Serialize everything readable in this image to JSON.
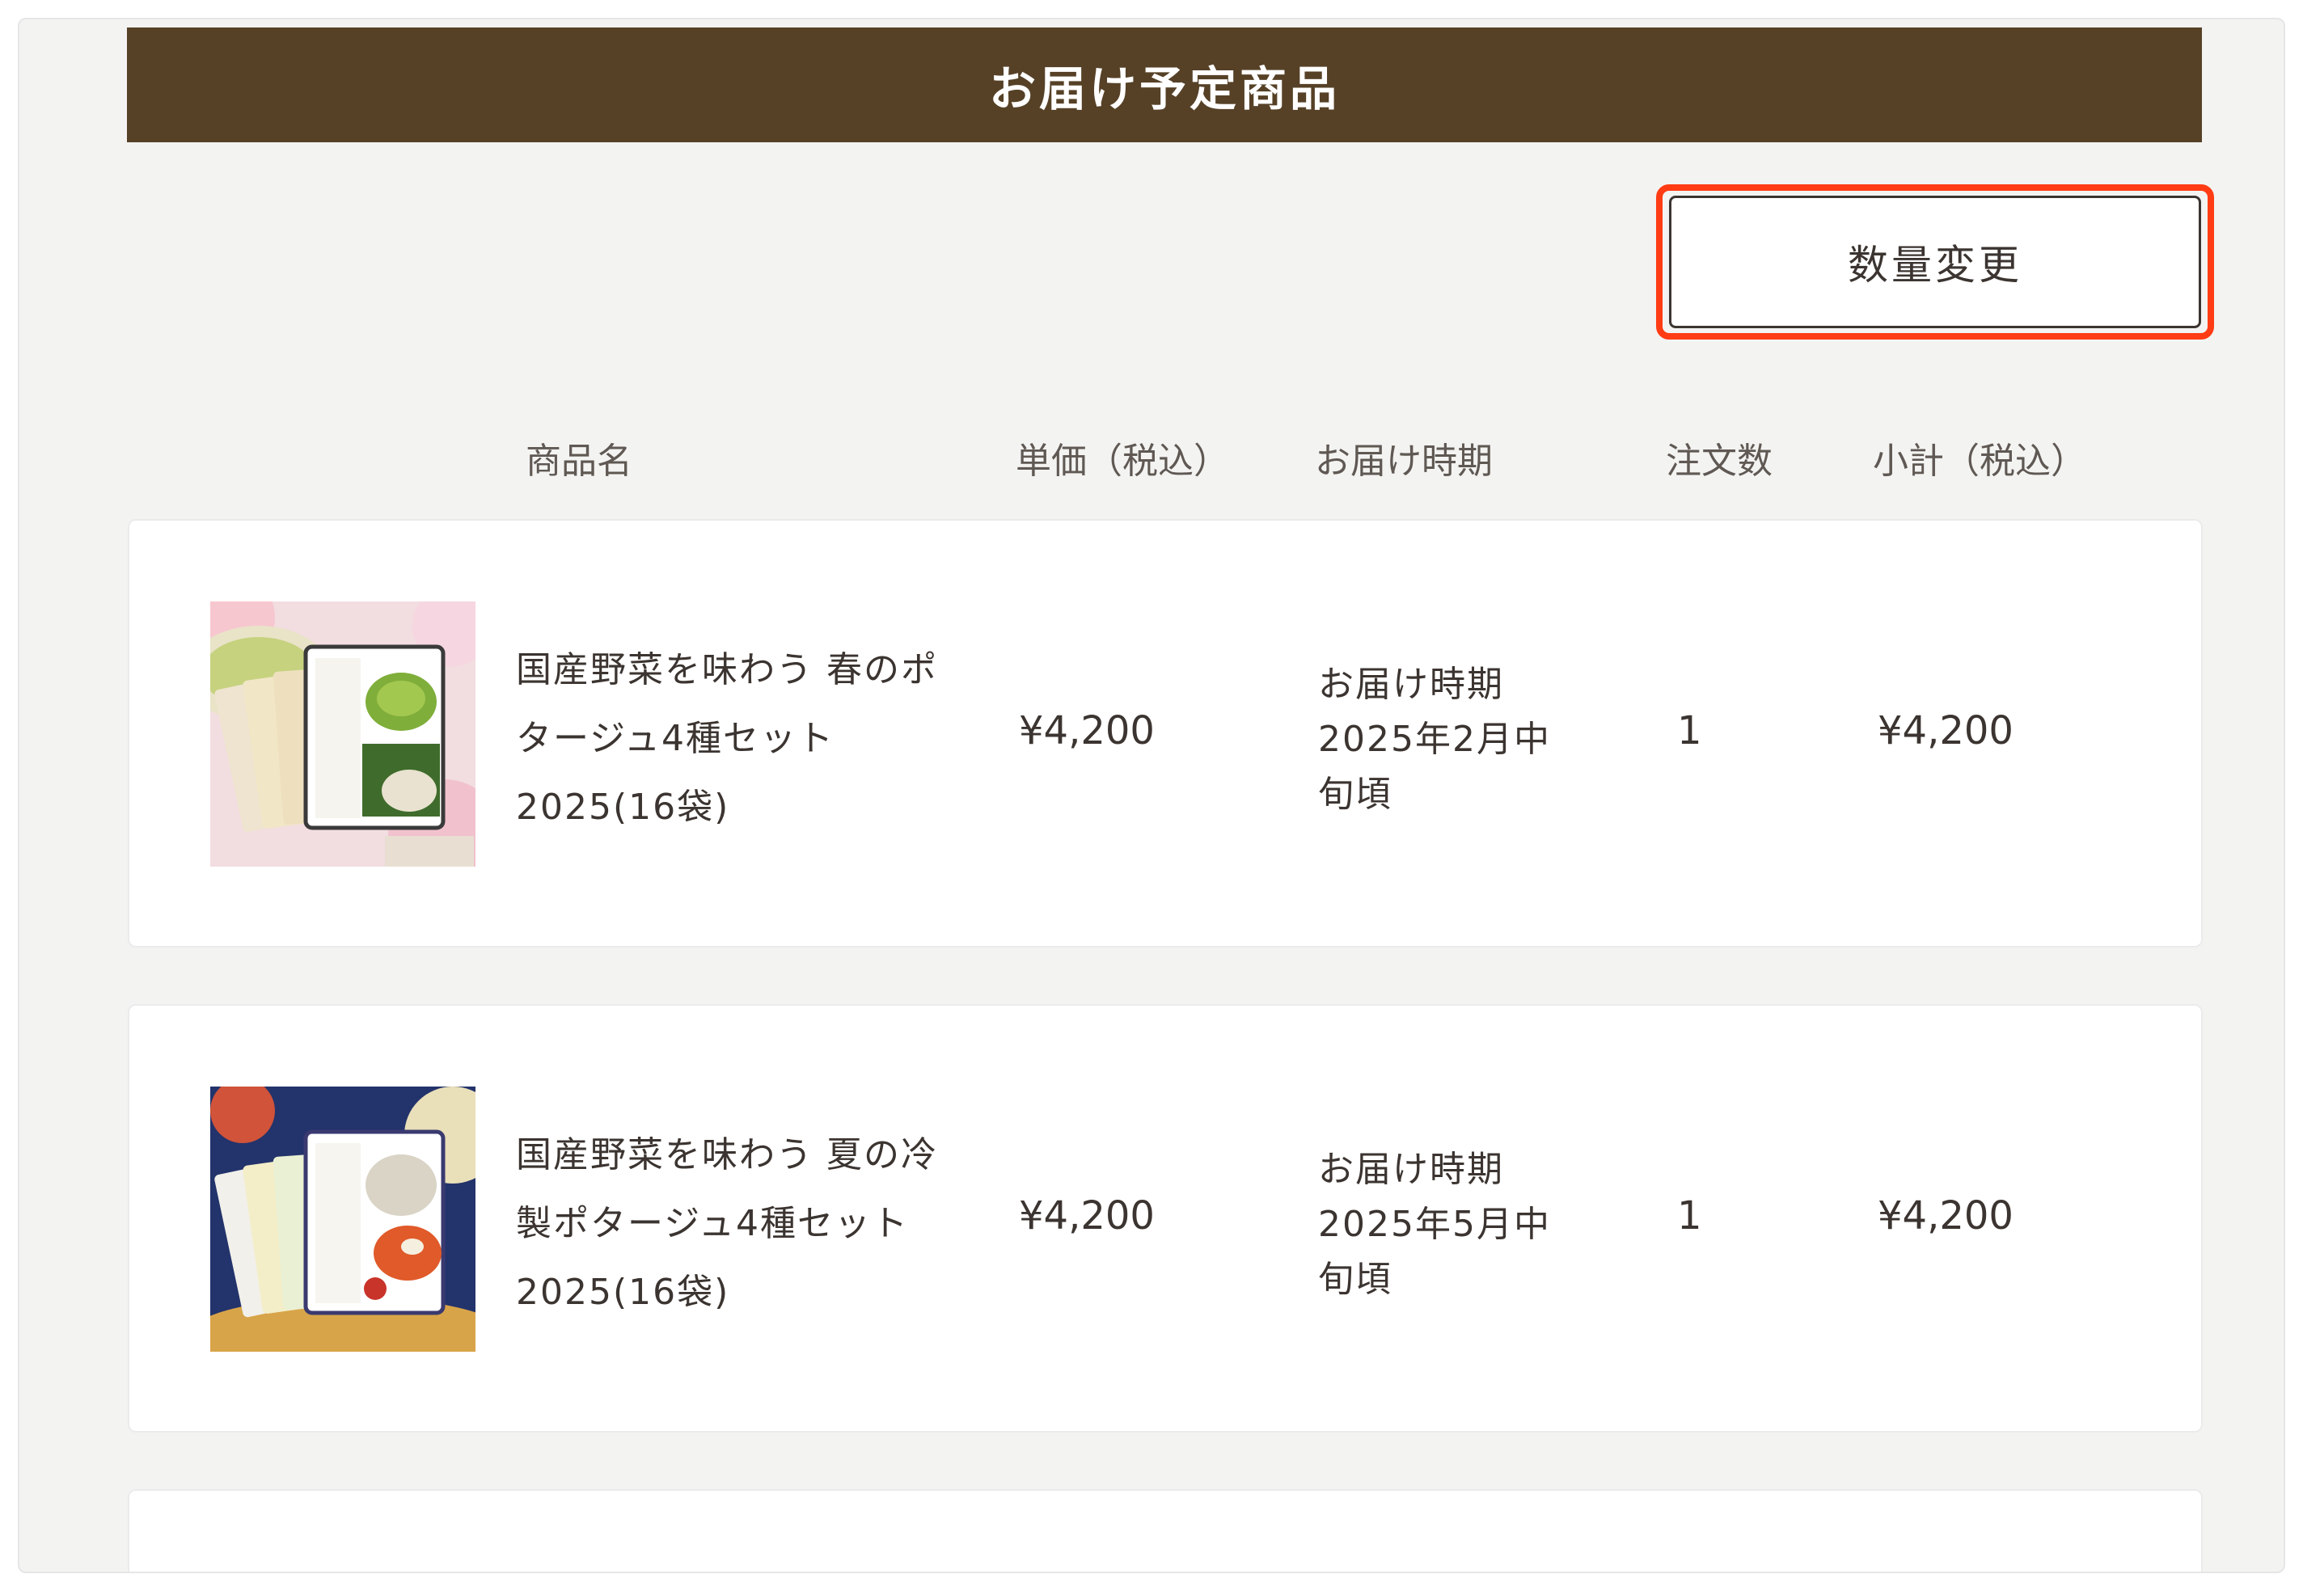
{
  "header": {
    "title": "お届け予定商品"
  },
  "toolbar": {
    "qty_change_label": "数量変更"
  },
  "columns": {
    "name": "商品名",
    "unit_price": "単価（税込）",
    "delivery": "お届け時期",
    "quantity": "注文数",
    "subtotal": "小計（税込）"
  },
  "items": [
    {
      "name_lines": [
        "国産野菜を味わう 春のポ",
        "タージュ4種セット",
        "2025(16袋)"
      ],
      "price": "¥4,200",
      "delivery_lines": [
        "お届け時期",
        "2025年2月中",
        "旬頃"
      ],
      "quantity": "1",
      "subtotal": "¥4,200"
    },
    {
      "name_lines": [
        "国産野菜を味わう 夏の冷",
        "製ポタージュ4種セット",
        "2025(16袋)"
      ],
      "price": "¥4,200",
      "delivery_lines": [
        "お届け時期",
        "2025年5月中",
        "旬頃"
      ],
      "quantity": "1",
      "subtotal": "¥4,200"
    }
  ],
  "colors": {
    "header_bg": "#564127",
    "highlight": "#ff3c14",
    "page_bg": "#f3f3f2"
  }
}
